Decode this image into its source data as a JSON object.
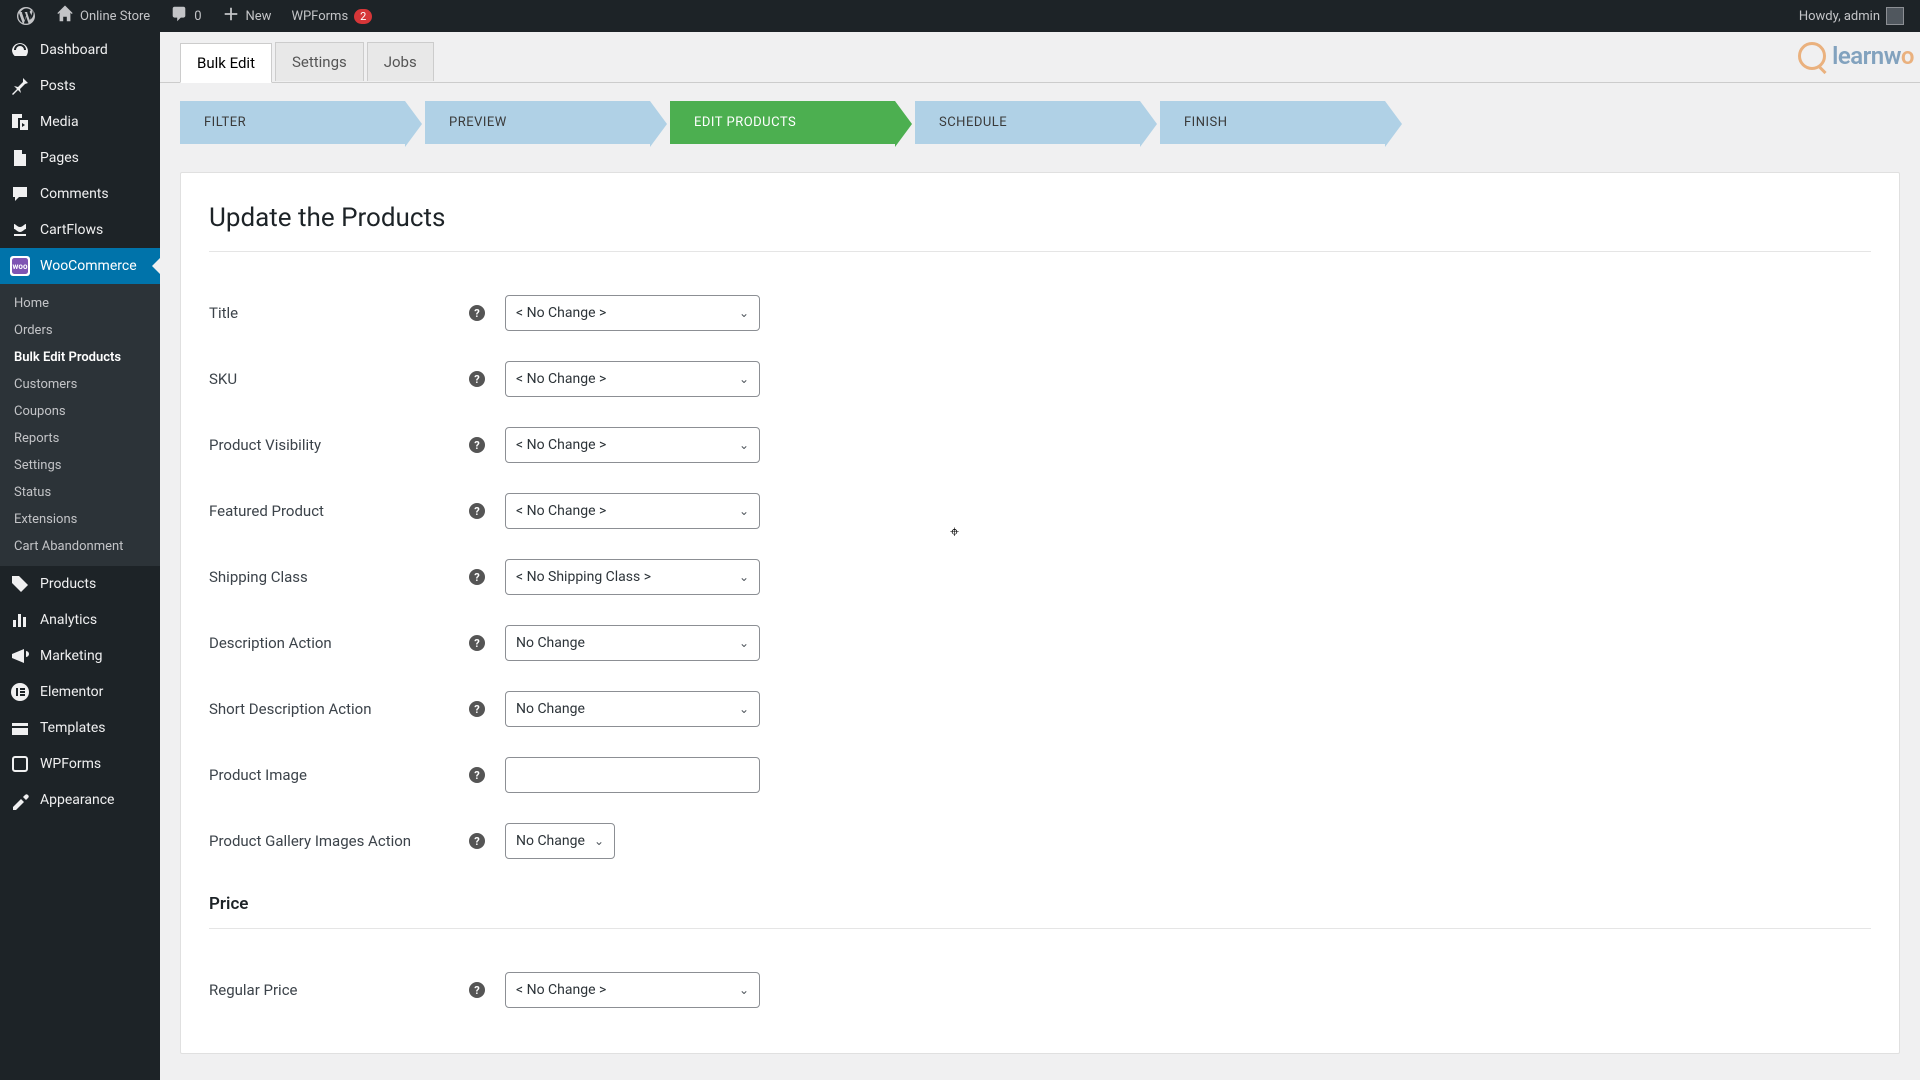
{
  "adminbar": {
    "site_name": "Online Store",
    "comments_count": "0",
    "new_label": "New",
    "wpforms_label": "WPForms",
    "wpforms_badge": "2",
    "howdy": "Howdy, admin"
  },
  "sidebar": {
    "items": [
      {
        "label": "Dashboard",
        "icon": "dashboard"
      },
      {
        "label": "Posts",
        "icon": "pin"
      },
      {
        "label": "Media",
        "icon": "media"
      },
      {
        "label": "Pages",
        "icon": "pages"
      },
      {
        "label": "Comments",
        "icon": "comments"
      },
      {
        "label": "CartFlows",
        "icon": "cartflows"
      },
      {
        "label": "WooCommerce",
        "icon": "woo",
        "current": true
      },
      {
        "label": "Products",
        "icon": "products"
      },
      {
        "label": "Analytics",
        "icon": "analytics"
      },
      {
        "label": "Marketing",
        "icon": "marketing"
      },
      {
        "label": "Elementor",
        "icon": "elementor"
      },
      {
        "label": "Templates",
        "icon": "templates"
      },
      {
        "label": "WPForms",
        "icon": "wpforms"
      },
      {
        "label": "Appearance",
        "icon": "appearance"
      }
    ],
    "submenu": [
      {
        "label": "Home"
      },
      {
        "label": "Orders"
      },
      {
        "label": "Bulk Edit Products",
        "current": true
      },
      {
        "label": "Customers"
      },
      {
        "label": "Coupons"
      },
      {
        "label": "Reports"
      },
      {
        "label": "Settings"
      },
      {
        "label": "Status"
      },
      {
        "label": "Extensions"
      },
      {
        "label": "Cart Abandonment"
      }
    ]
  },
  "tabs": [
    {
      "label": "Bulk Edit",
      "active": true
    },
    {
      "label": "Settings"
    },
    {
      "label": "Jobs"
    }
  ],
  "steps": [
    {
      "label": "FILTER"
    },
    {
      "label": "PREVIEW"
    },
    {
      "label": "EDIT PRODUCTS",
      "active": true
    },
    {
      "label": "SCHEDULE"
    },
    {
      "label": "FINISH"
    }
  ],
  "page": {
    "title": "Update the Products",
    "price_section_title": "Price"
  },
  "fields": {
    "title": {
      "label": "Title",
      "value": "< No Change >"
    },
    "sku": {
      "label": "SKU",
      "value": "< No Change >"
    },
    "product_visibility": {
      "label": "Product Visibility",
      "value": "< No Change >"
    },
    "featured_product": {
      "label": "Featured Product",
      "value": "< No Change >"
    },
    "shipping_class": {
      "label": "Shipping Class",
      "value": "< No Shipping Class >"
    },
    "description_action": {
      "label": "Description Action",
      "value": "No Change"
    },
    "short_description_action": {
      "label": "Short Description Action",
      "value": "No Change"
    },
    "product_image": {
      "label": "Product Image",
      "value": ""
    },
    "gallery_action": {
      "label": "Product Gallery Images Action",
      "value": "No Change"
    },
    "regular_price": {
      "label": "Regular Price",
      "value": "< No Change >"
    }
  },
  "watermark": {
    "brand_part1": "learn",
    "brand_part2": "w",
    "brand_part3": "o"
  }
}
